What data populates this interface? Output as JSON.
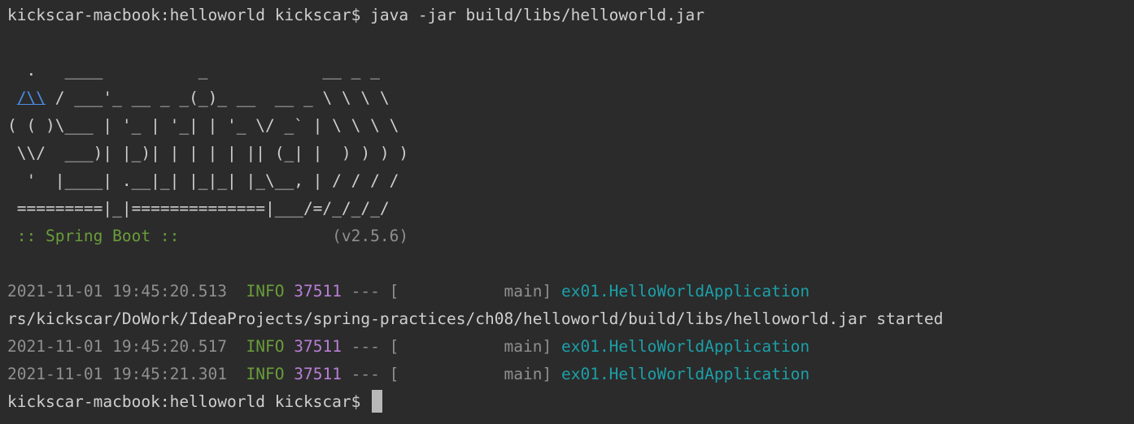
{
  "terminal": {
    "prompt": "kickscar-macbook:helloworld kickscar$",
    "command": " java -jar build/libs/helloworld.jar",
    "banner": {
      "line1": "  .   ____          _            __ _ _",
      "line2_link": "/\\\\",
      "line2_rest": " / ___'_ __ _ _(_)_ __  __ _ \\ \\ \\ \\",
      "line3": "( ( )\\___ | '_ | '_| | '_ \\/ _` | \\ \\ \\ \\",
      "line4": " \\\\/  ___)| |_)| | | | | || (_| |  ) ) ) )",
      "line5": "  '  |____| .__|_| |_|_| |_\\__, | / / / /",
      "line6": " =========|_|==============|___/=/_/_/_/",
      "spring_label": " :: Spring Boot ::",
      "version": "                (v2.5.6)"
    },
    "logs": [
      {
        "timestamp": "2021-11-01 19:45:20.513",
        "level": "INFO",
        "pid": "37511",
        "sep": " --- [",
        "thread": "           main]",
        "logger": "ex01.HelloWorldApplication"
      },
      {
        "timestamp": "2021-11-01 19:45:20.517",
        "level": "INFO",
        "pid": "37511",
        "sep": " --- [",
        "thread": "           main]",
        "logger": "ex01.HelloWorldApplication"
      },
      {
        "timestamp": "2021-11-01 19:45:21.301",
        "level": "INFO",
        "pid": "37511",
        "sep": " --- [",
        "thread": "           main]",
        "logger": "ex01.HelloWorldApplication"
      }
    ],
    "wrapped_line": "rs/kickscar/DoWork/IdeaProjects/spring-practices/ch08/helloworld/build/libs/helloworld.jar started",
    "final_prompt": "kickscar-macbook:helloworld kickscar$ "
  },
  "colors": {
    "background": "#2b2b2b",
    "text": "#cfcfcf",
    "dim": "#8f8f8f",
    "green": "#6a9d3a",
    "purple": "#b87fd6",
    "cyan": "#1ba0a8",
    "link": "#4a8fe8"
  }
}
